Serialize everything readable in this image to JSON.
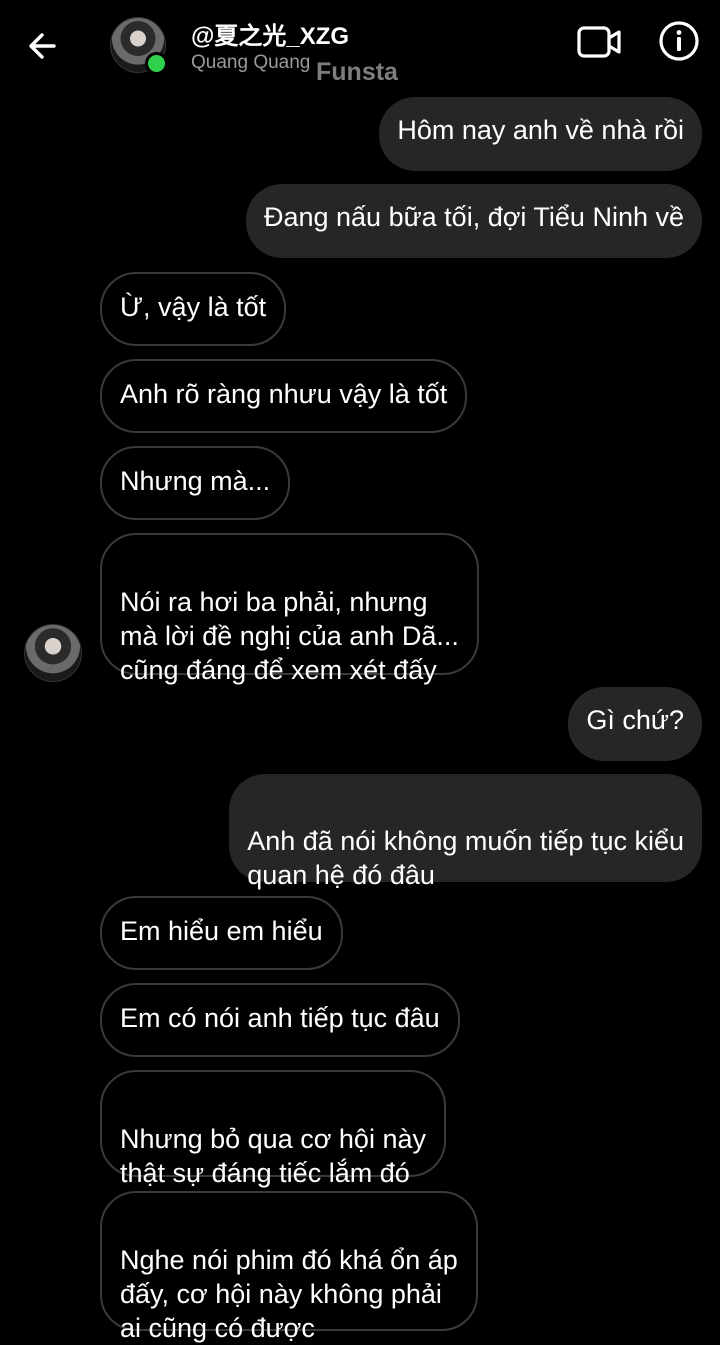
{
  "header": {
    "username": "@夏之光_XZG",
    "subtitle": "Quang Quang",
    "watermark": "Funsta",
    "back_icon": "arrow-left-icon",
    "video_icon": "video-camera-icon",
    "info_icon": "info-icon",
    "online_color": "#2fd14d"
  },
  "messages": [
    {
      "dir": "sent",
      "text": "Hôm nay anh về nhà rồi"
    },
    {
      "dir": "sent",
      "text": "Đang nấu bữa tối, đợi Tiểu Ninh về"
    },
    {
      "dir": "recv",
      "text": "Ừ, vậy là tốt"
    },
    {
      "dir": "recv",
      "text": "Anh rõ ràng nhưu vậy là tốt"
    },
    {
      "dir": "recv",
      "text": "Nhưng mà..."
    },
    {
      "dir": "recv",
      "text": "Nói ra hơi ba phải, nhưng\nmà lời đề nghị của anh Dã...\ncũng đáng để xem xét đấy"
    },
    {
      "dir": "sent",
      "text": "Gì chứ?"
    },
    {
      "dir": "sent",
      "text": "Anh đã nói không muốn tiếp tục kiểu\nquan hệ đó đâu"
    },
    {
      "dir": "recv",
      "text": "Em hiểu em hiểu"
    },
    {
      "dir": "recv",
      "text": "Em có nói anh tiếp tục đâu"
    },
    {
      "dir": "recv",
      "text": "Nhưng bỏ qua cơ hội này\nthật sự đáng tiếc lắm đó"
    },
    {
      "dir": "recv",
      "text": "Nghe nói phim đó khá ổn áp\nđấy, cơ hội này không phải\nai cũng có được"
    }
  ],
  "colors": {
    "sent_bubble": "#262626",
    "recv_border": "#3a3a3a",
    "background": "#000000"
  }
}
